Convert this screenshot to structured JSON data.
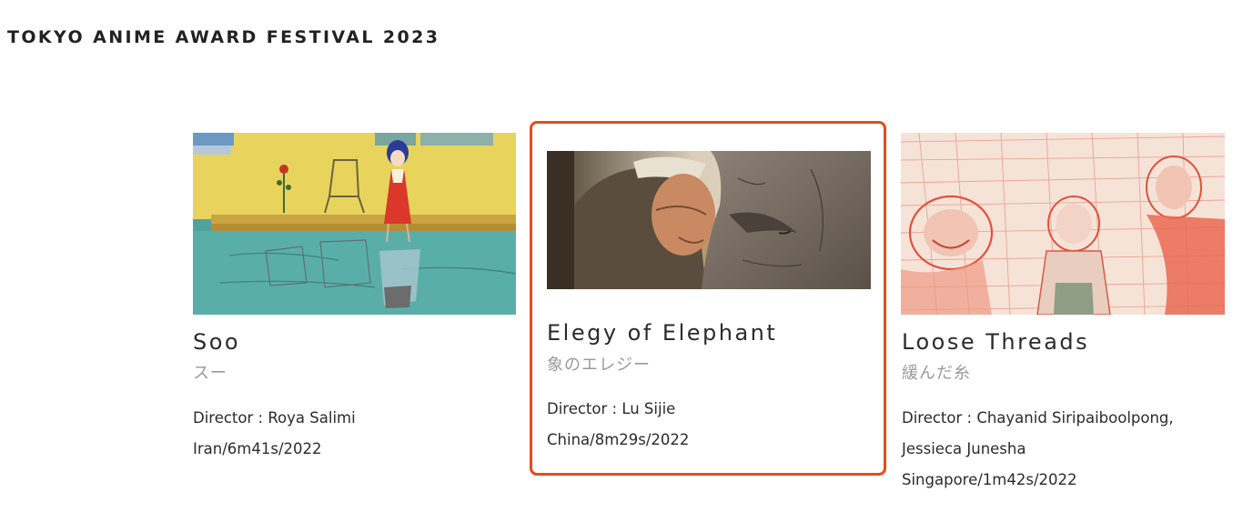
{
  "festival": {
    "title": "TOKYO ANIME AWARD FESTIVAL 2023"
  },
  "films": [
    {
      "title": "Soo",
      "title_ja": "スー",
      "director": "Director : Roya Salimi",
      "info": "Iran/6m41s/2022",
      "thumbnail": "soo-still-image",
      "selected": false
    },
    {
      "title": "Elegy of Elephant",
      "title_ja": "象のエレジー",
      "director": "Director : Lu Sijie",
      "info": "China/8m29s/2022",
      "thumbnail": "elegy-of-elephant-still-image",
      "selected": true,
      "highlight_color": "#ea4a1c"
    },
    {
      "title": "Loose Threads",
      "title_ja": "緩んだ糸",
      "director": "Director : Chayanid Siripaiboolpong,",
      "director_cont": "Jessieca Junesha",
      "info": "Singapore/1m42s/2022",
      "thumbnail": "loose-threads-still-image",
      "selected": false
    }
  ]
}
